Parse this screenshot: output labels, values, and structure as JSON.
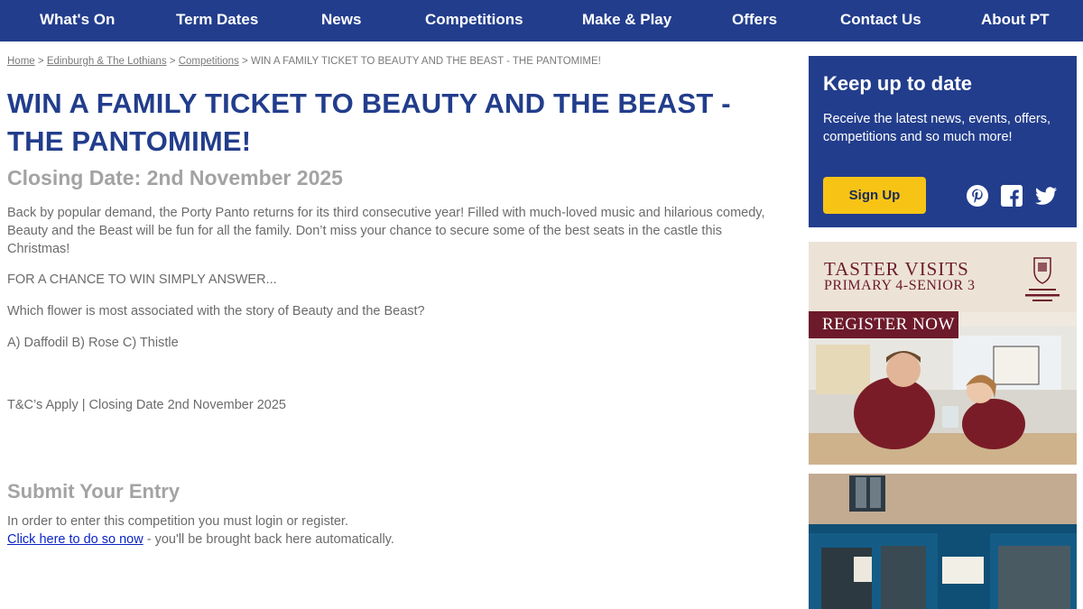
{
  "nav": {
    "items": [
      "What's On",
      "Term Dates",
      "News",
      "Competitions",
      "Make & Play",
      "Offers",
      "Contact Us",
      "About PT"
    ]
  },
  "breadcrumb": {
    "home": "Home",
    "sep": ">",
    "region": "Edinburgh & The Lothians",
    "section": "Competitions",
    "current": "WIN A FAMILY TICKET TO BEAUTY AND THE BEAST - THE PANTOMIME!"
  },
  "article": {
    "title": "WIN A FAMILY TICKET TO BEAUTY AND THE BEAST - THE PANTOMIME!",
    "closing_date": "Closing Date: 2nd November 2025",
    "intro": "Back by popular demand, the Porty Panto returns for its third consecutive year! Filled with much-loved music and hilarious comedy, Beauty and the Beast will be fun for all the family. Don’t miss your chance to secure some of the best seats in the castle this Christmas!",
    "prompt": "FOR A CHANCE TO WIN SIMPLY ANSWER...",
    "question": "Which  flower is most associated with the story of Beauty and the Beast?",
    "answers": "A) Daffodil B) Rose C) Thistle",
    "terms": "T&C’s Apply | Closing Date 2nd November 2025"
  },
  "submit": {
    "title": "Submit Your Entry",
    "login_text": "In order to enter this competition you must login or register.",
    "link_text": "Click here to do so now",
    "after_link": " - you'll be brought back here automatically."
  },
  "sidebar": {
    "signup": {
      "title": "Keep up to date",
      "text": "Receive the latest news, events, offers, competitions and so much more!",
      "button": "Sign Up"
    },
    "ad1": {
      "line1": "TASTER VISITS",
      "line2": "PRIMARY 4-SENIOR 3",
      "cta": "REGISTER NOW"
    }
  },
  "colors": {
    "brand_blue": "#223d8c",
    "button_yellow": "#f7c416",
    "ad_maroon": "#6d1a2b"
  }
}
